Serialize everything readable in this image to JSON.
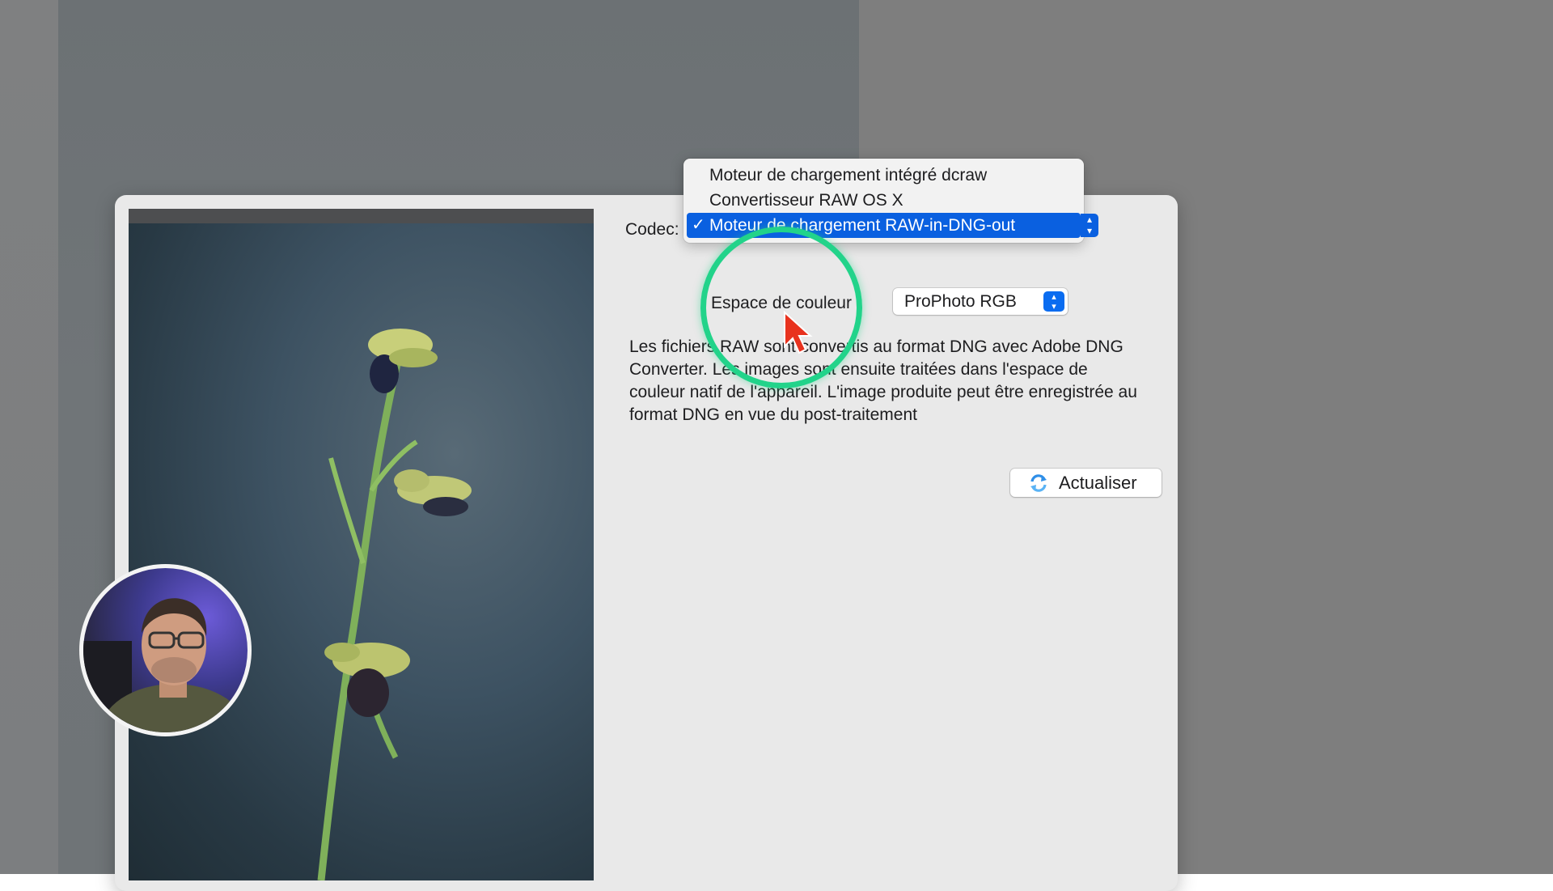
{
  "dialog": {
    "codec": {
      "label": "Codec:",
      "options": [
        {
          "label": "Moteur de chargement intégré dcraw",
          "selected": false
        },
        {
          "label": "Convertisseur RAW OS X",
          "selected": false
        },
        {
          "label": "Moteur de chargement RAW-in-DNG-out",
          "selected": true
        }
      ],
      "check_glyph": "✓"
    },
    "color_space": {
      "label": "Espace de couleur :",
      "value": "ProPhoto RGB"
    },
    "description": "Les fichiers RAW sont convertis au format DNG avec Adobe DNG Converter. Les images sont ensuite traitées dans l'espace de couleur natif de l'appareil. L'image produite peut être enregistrée au format DNG en vue du post-traitement",
    "refresh_button": {
      "label": "Actualiser",
      "icon": "refresh-icon"
    }
  },
  "colors": {
    "accent": "#0a60e0",
    "highlight_ring": "#22d38a",
    "cursor": "#e8321e"
  }
}
